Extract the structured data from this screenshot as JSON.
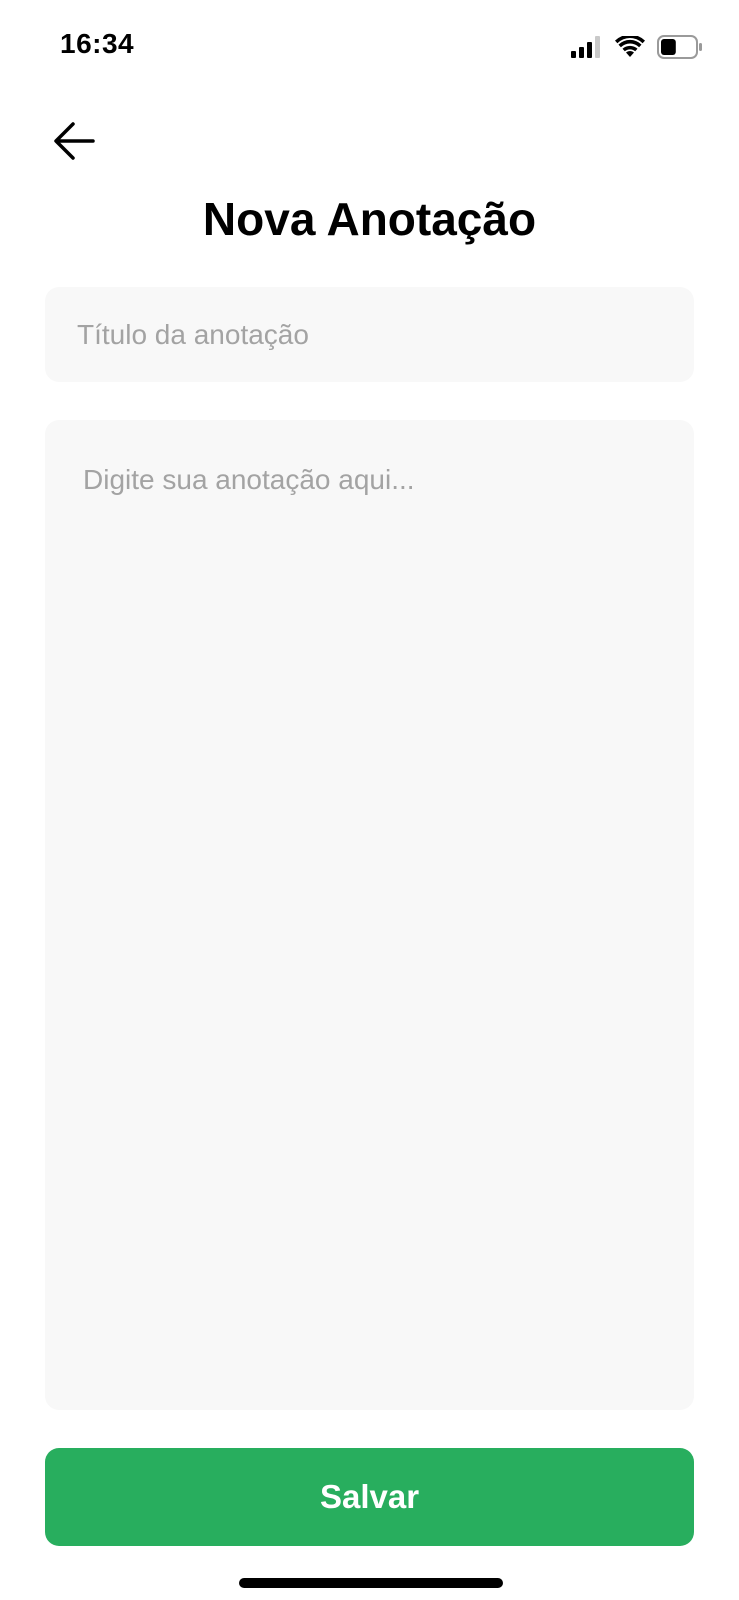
{
  "status_bar": {
    "time": "16:34",
    "icons": [
      "cellular-signal-icon",
      "wifi-icon",
      "battery-icon"
    ],
    "battery_level": 0.45
  },
  "header": {
    "back_icon": "arrow-left-icon",
    "title": "Nova Anotação"
  },
  "form": {
    "title_field": {
      "value": "",
      "placeholder": "Título da anotação"
    },
    "body_field": {
      "value": "",
      "placeholder": "Digite sua anotação aqui..."
    },
    "save_label": "Salvar"
  },
  "colors": {
    "accent": "#28ae5e",
    "field_background": "#f8f8f8",
    "placeholder": "#a3a3a3",
    "text": "#000000"
  }
}
